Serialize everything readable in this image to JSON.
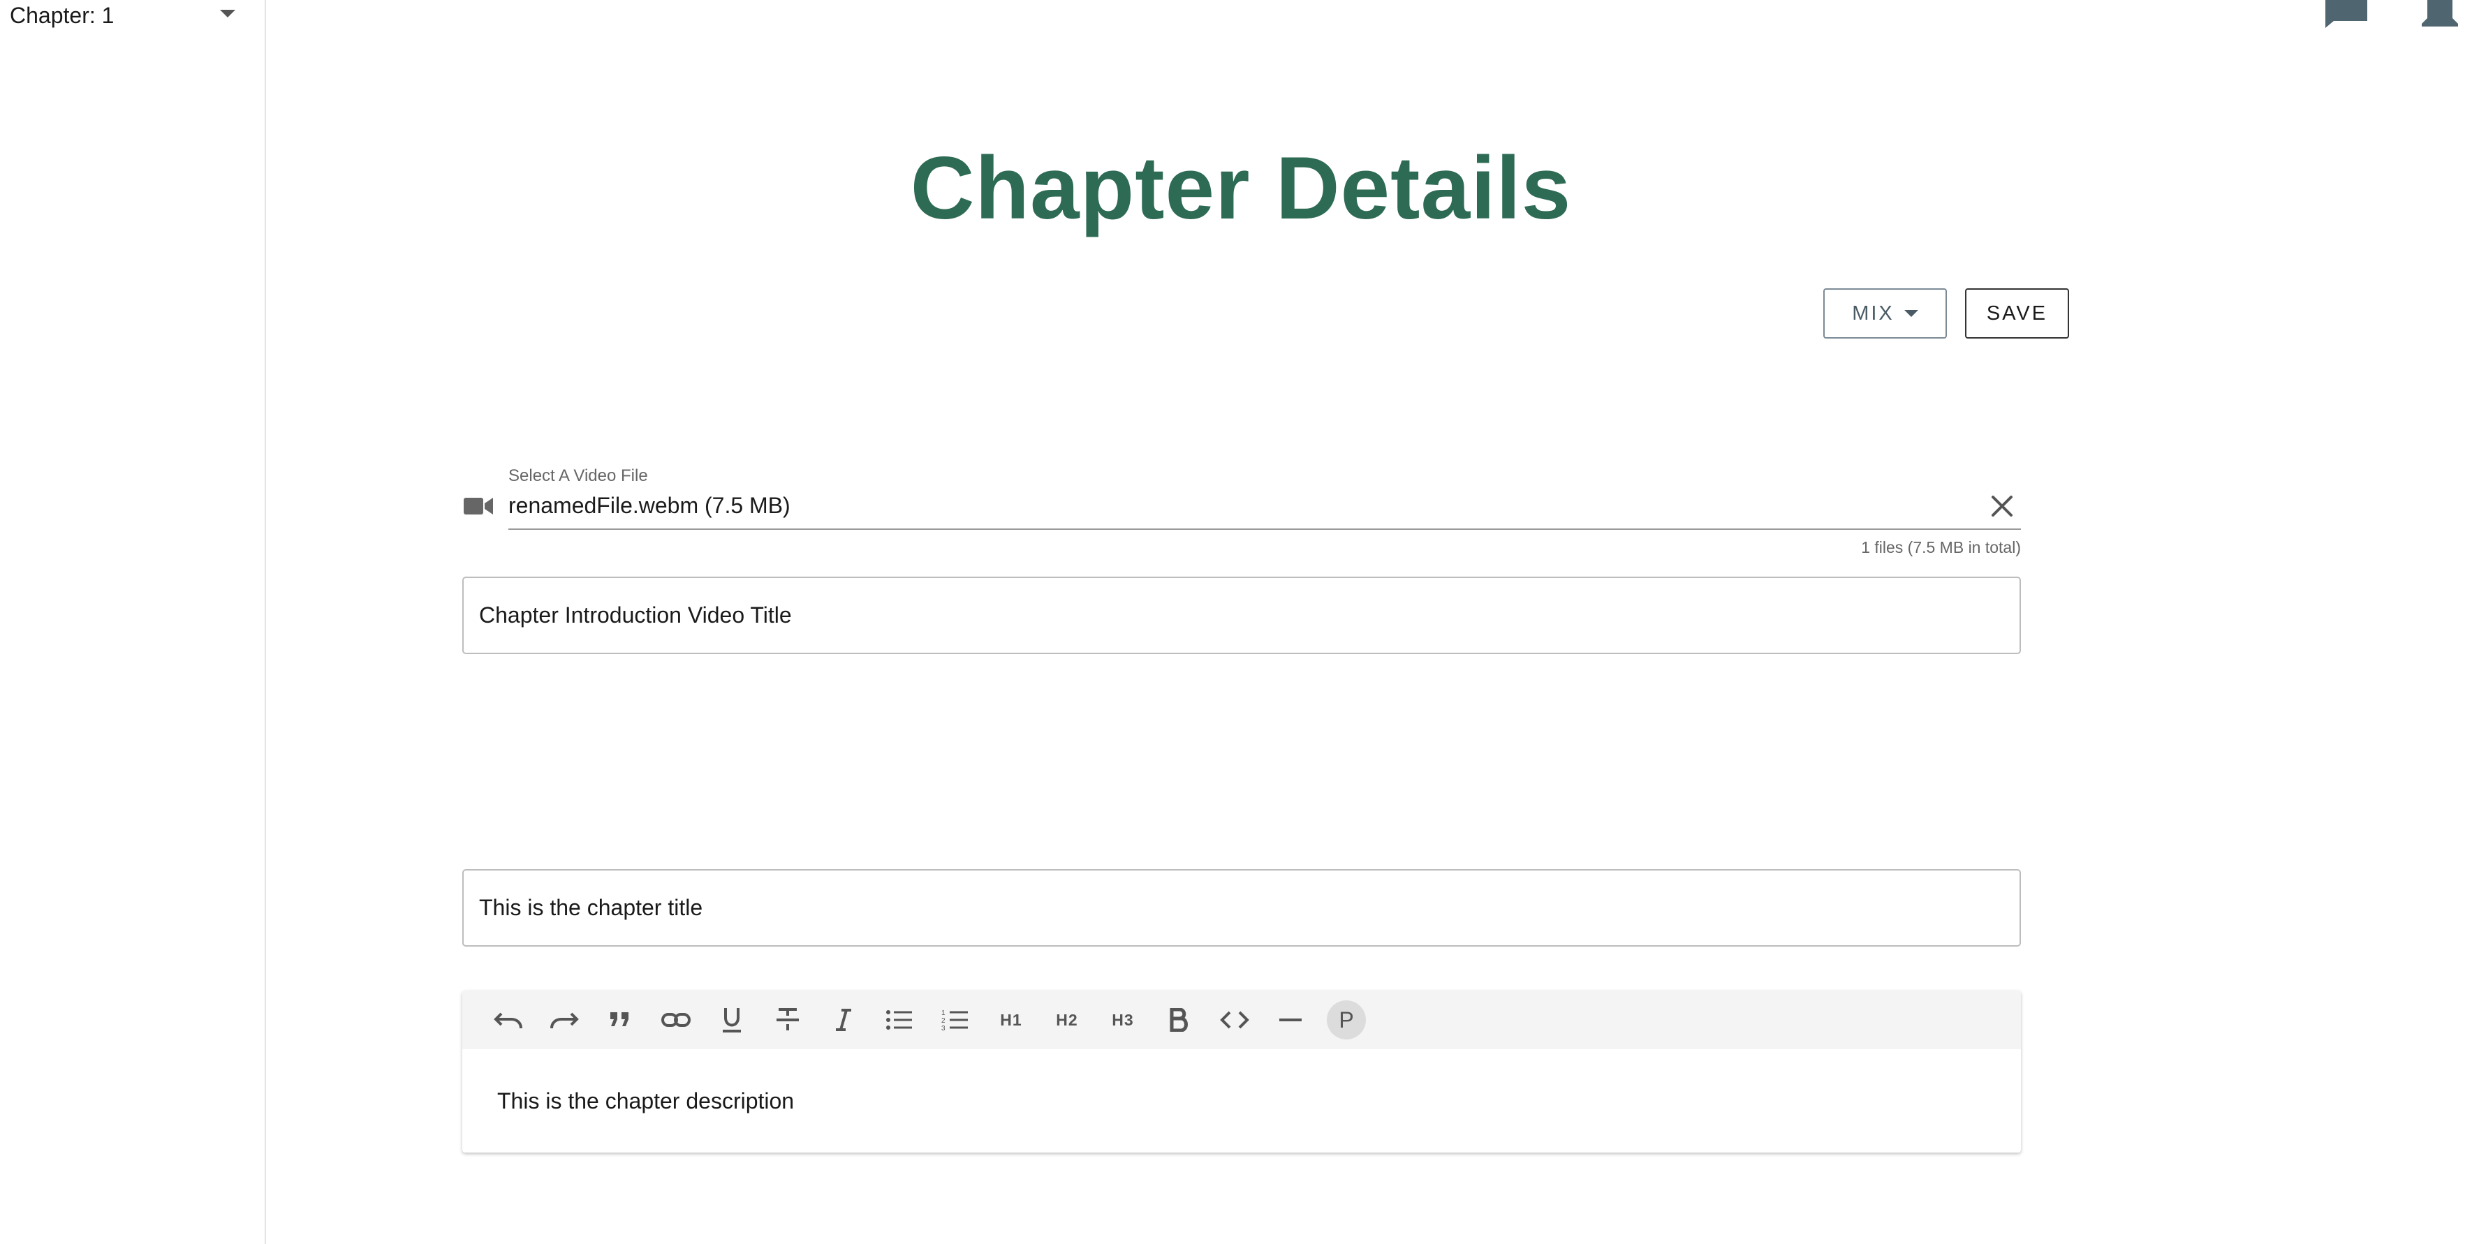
{
  "sidebar": {
    "chapter_select_label": "Chapter: 1"
  },
  "header": {
    "chat_icon": "chat-bubble-icon",
    "bell_icon": "notifications-icon"
  },
  "page": {
    "title": "Chapter Details"
  },
  "actions": {
    "mix_label": "MIX",
    "save_label": "SAVE"
  },
  "video_file": {
    "label": "Select A Video File",
    "value": "renamedFile.webm (7.5 MB)",
    "summary": "1 files (7.5 MB in total)"
  },
  "video_title": {
    "value": "Chapter Introduction Video Title"
  },
  "chapter_title": {
    "value": "This is the chapter title"
  },
  "editor": {
    "toolbar": {
      "h1": "H1",
      "h2": "H2",
      "h3": "H3",
      "paragraph": "P"
    },
    "content": "This is the chapter description"
  },
  "colors": {
    "title": "#2e6b55",
    "accent": "#4a5b66"
  }
}
